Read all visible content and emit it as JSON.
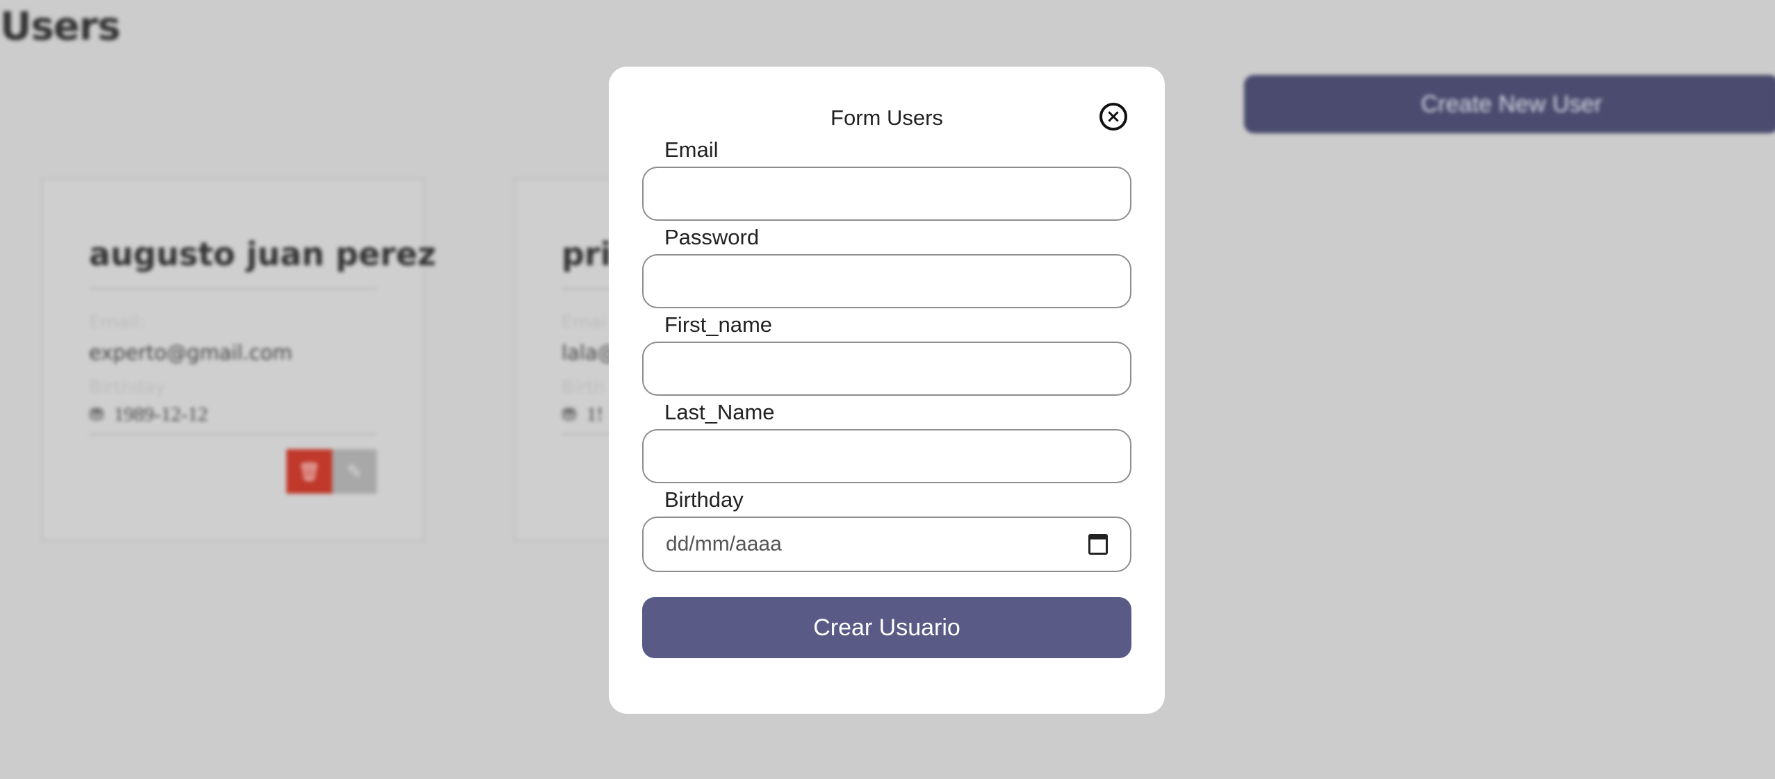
{
  "page": {
    "title": "Users",
    "create_button": "Create New User"
  },
  "cards": [
    {
      "name": "augusto juan perez",
      "email_label": "Email:",
      "email": "experto@gmail.com",
      "birthday_label": "Birthday",
      "birthday": "1989-12-12"
    },
    {
      "name": "pri",
      "email_label": "Emai",
      "email": "lala@",
      "birthday_label": "Birth",
      "birthday": "1!"
    }
  ],
  "modal": {
    "title": "Form Users",
    "fields": {
      "email_label": "Email",
      "email_value": "",
      "password_label": "Password",
      "password_value": "",
      "first_name_label": "First_name",
      "first_name_value": "",
      "last_name_label": "Last_Name",
      "last_name_value": "",
      "birthday_label": "Birthday",
      "birthday_placeholder": "dd/mm/aaaa"
    },
    "submit_label": "Crear Usuario"
  },
  "colors": {
    "backdrop": "#cccccc",
    "primary_button": "#595b86",
    "delete_button": "#c0392b",
    "edit_button": "#a8a8a8"
  },
  "icons": {
    "close": "close-circle-icon",
    "calendar": "calendar-icon",
    "birthday": "cake-icon",
    "delete": "trash-icon",
    "edit": "edit-icon"
  }
}
